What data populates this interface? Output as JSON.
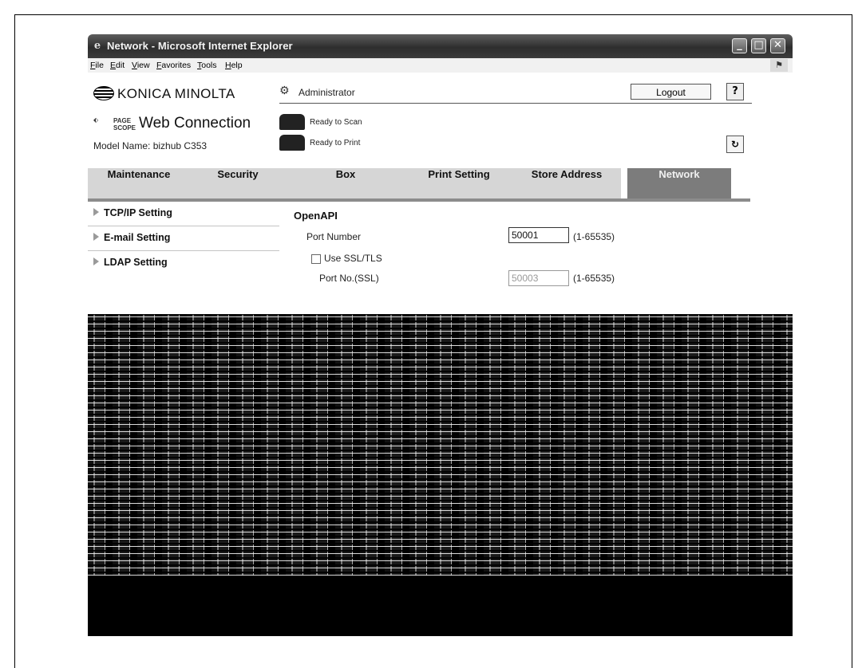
{
  "window": {
    "title": "Network - Microsoft Internet Explorer",
    "controls": {
      "minimize": "_",
      "maximize": "□",
      "close": "✕"
    }
  },
  "menubar": [
    "File",
    "Edit",
    "View",
    "Favorites",
    "Tools",
    "Help"
  ],
  "header": {
    "brand": "KONICA MINOLTA",
    "page_scope": "PAGE SCOPE",
    "web_connection": "Web Connection",
    "model_name": "Model Name: bizhub C353",
    "user": "Administrator",
    "logout_label": "Logout",
    "help_label": "?",
    "refresh_label": "↻",
    "status": [
      {
        "icon": "scanner-icon",
        "text": "Ready to Scan"
      },
      {
        "icon": "printer-icon",
        "text": "Ready to Print"
      }
    ]
  },
  "tabs": [
    {
      "label": "Maintenance",
      "active": false
    },
    {
      "label": "Security",
      "active": false
    },
    {
      "label": "Box",
      "active": false
    },
    {
      "label": "Print Setting",
      "active": false
    },
    {
      "label": "Store Address",
      "active": false
    },
    {
      "label": "Network",
      "active": true
    }
  ],
  "sidebar": {
    "items": [
      "TCP/IP Setting",
      "E-mail Setting",
      "LDAP Setting"
    ]
  },
  "form": {
    "section_title": "OpenAPI",
    "port_number": {
      "label": "Port Number",
      "value": "50001",
      "range": "(1-65535)"
    },
    "use_ssl": {
      "label": "Use SSL/TLS",
      "checked": false
    },
    "port_ssl": {
      "label": "Port No.(SSL)",
      "value": "50003",
      "range": "(1-65535)"
    }
  },
  "colors": {
    "titlebar": "#3c3c3c",
    "active_tab": "#7c7c7c",
    "inactive_tab": "#d6d6d6",
    "tab_underline": "#8c8c8c"
  }
}
